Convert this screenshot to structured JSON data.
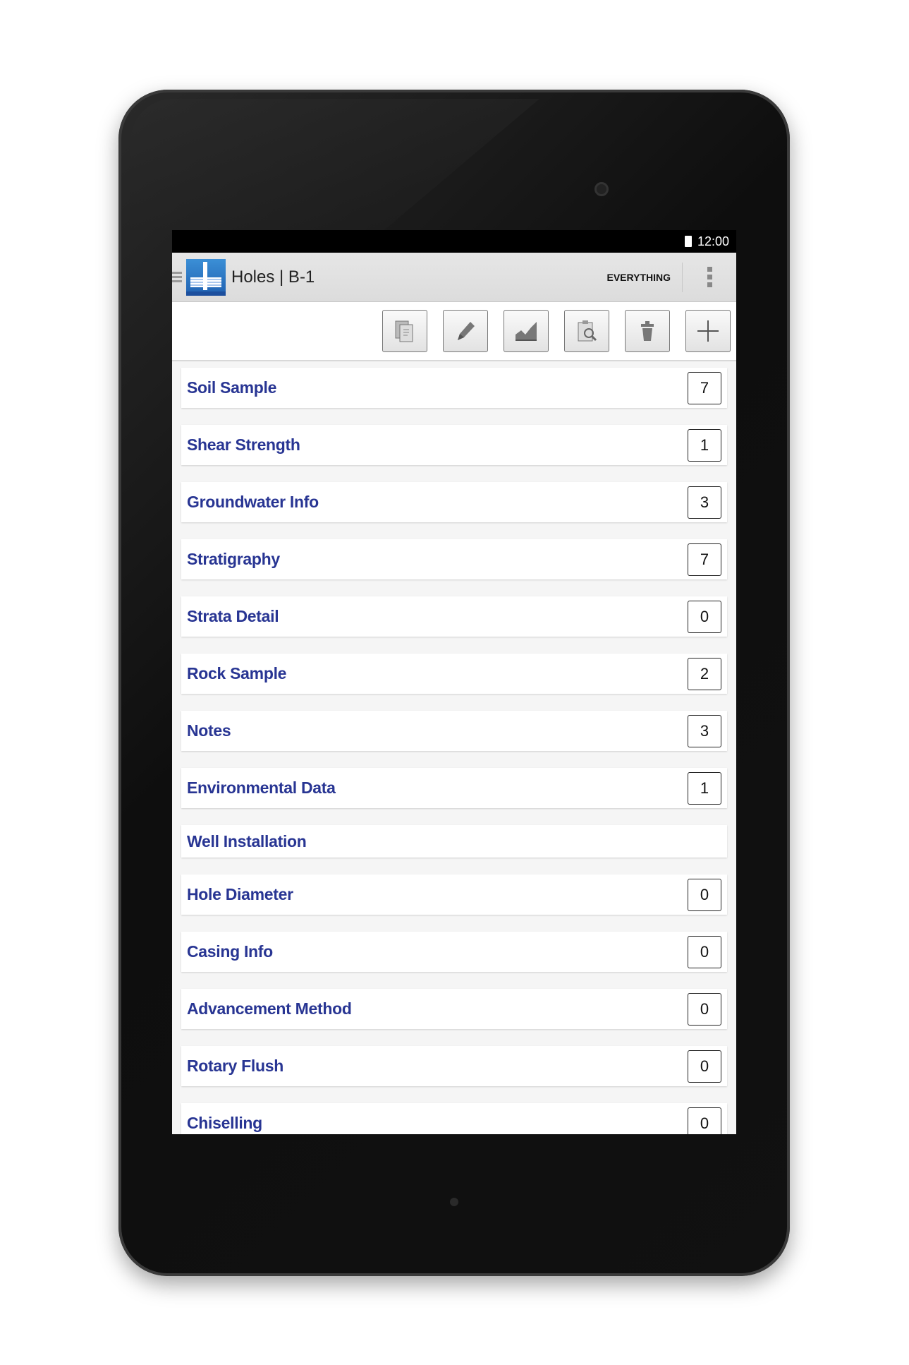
{
  "status_bar": {
    "time": "12:00"
  },
  "action_bar": {
    "title": "Holes | B-1",
    "filter": "EVERYTHING"
  },
  "toolbar": {
    "buttons": [
      "copy-icon",
      "edit-icon",
      "chart-icon",
      "clipboard-search-icon",
      "trash-icon",
      "add-icon"
    ]
  },
  "colors": {
    "label": "#283593",
    "action_bar": "#e0e0e0"
  },
  "items": [
    {
      "label": "Soil Sample",
      "count": "7"
    },
    {
      "label": "Shear Strength",
      "count": "1"
    },
    {
      "label": "Groundwater Info",
      "count": "3"
    },
    {
      "label": "Stratigraphy",
      "count": "7"
    },
    {
      "label": "Strata Detail",
      "count": "0"
    },
    {
      "label": "Rock Sample",
      "count": "2"
    },
    {
      "label": "Notes",
      "count": "3"
    },
    {
      "label": "Environmental Data",
      "count": "1"
    },
    {
      "label": "Well Installation"
    },
    {
      "label": "Hole Diameter",
      "count": "0"
    },
    {
      "label": "Casing Info",
      "count": "0"
    },
    {
      "label": "Advancement Method",
      "count": "0"
    },
    {
      "label": "Rotary Flush",
      "count": "0"
    },
    {
      "label": "Chiselling",
      "count": "0"
    }
  ]
}
